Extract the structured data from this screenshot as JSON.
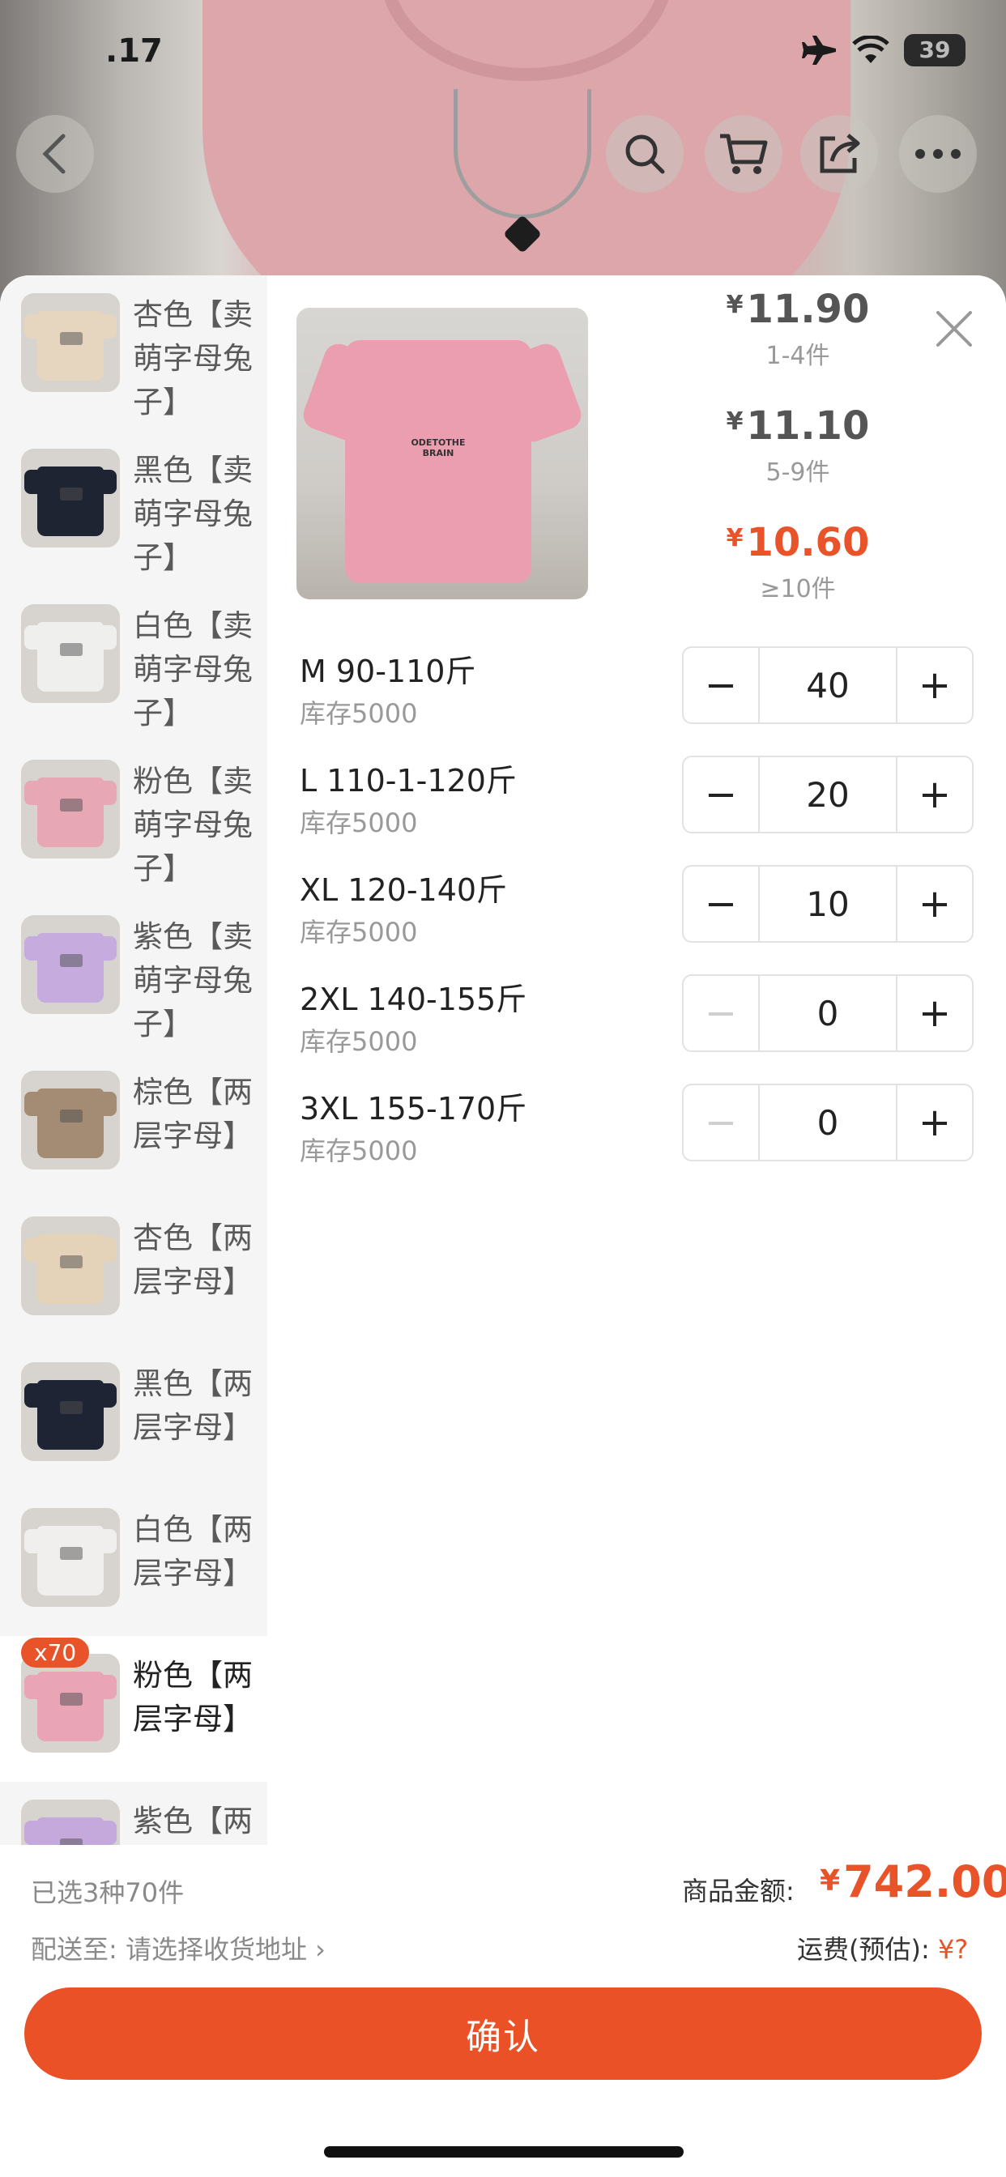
{
  "status": {
    "time": ".17",
    "battery": "39"
  },
  "colors": [
    {
      "name": "杏色【卖萌字母兔子】",
      "swatch": "#e6d5bf",
      "selected": false,
      "badge": ""
    },
    {
      "name": "黑色【卖萌字母兔子】",
      "swatch": "#1f2433",
      "selected": false,
      "badge": ""
    },
    {
      "name": "白色【卖萌字母兔子】",
      "swatch": "#efefee",
      "selected": false,
      "badge": ""
    },
    {
      "name": "粉色【卖萌字母兔子】",
      "swatch": "#e7a7b5",
      "selected": false,
      "badge": ""
    },
    {
      "name": "紫色【卖萌字母兔子】",
      "swatch": "#c5abde",
      "selected": false,
      "badge": ""
    },
    {
      "name": "棕色【两层字母】",
      "swatch": "#a38b74",
      "selected": false,
      "badge": ""
    },
    {
      "name": "杏色【两层字母】",
      "swatch": "#e4d3b8",
      "selected": false,
      "badge": ""
    },
    {
      "name": "黑色【两层字母】",
      "swatch": "#1e2433",
      "selected": false,
      "badge": ""
    },
    {
      "name": "白色【两层字母】",
      "swatch": "#f0efed",
      "selected": false,
      "badge": ""
    },
    {
      "name": "粉色【两层字母】",
      "swatch": "#e9a5b6",
      "selected": true,
      "badge": "x70"
    },
    {
      "name": "紫色【两层字母】",
      "swatch": "#c6a9dc",
      "selected": false,
      "badge": ""
    }
  ],
  "product_image": {
    "print_text": "ODETOTHE BRAIN"
  },
  "price_tiers": [
    {
      "yen": "¥",
      "price": "11.90",
      "range": "1-4件",
      "active": false
    },
    {
      "yen": "¥",
      "price": "11.10",
      "range": "5-9件",
      "active": false
    },
    {
      "yen": "¥",
      "price": "10.60",
      "range": "≥10件",
      "active": true
    }
  ],
  "sizes": [
    {
      "label": "M 90-110斤",
      "stock": "库存5000",
      "qty": "40",
      "minus": "−",
      "plus": "+",
      "minus_disabled": false
    },
    {
      "label": "L 110-1-120斤",
      "stock": "库存5000",
      "qty": "20",
      "minus": "−",
      "plus": "+",
      "minus_disabled": false
    },
    {
      "label": "XL 120-140斤",
      "stock": "库存5000",
      "qty": "10",
      "minus": "−",
      "plus": "+",
      "minus_disabled": false
    },
    {
      "label": "2XL 140-155斤",
      "stock": "库存5000",
      "qty": "0",
      "minus": "−",
      "plus": "+",
      "minus_disabled": true
    },
    {
      "label": "3XL 155-170斤",
      "stock": "库存5000",
      "qty": "0",
      "minus": "−",
      "plus": "+",
      "minus_disabled": true
    }
  ],
  "summary": {
    "selected_text": "已选3种70件",
    "amount_label": "商品金额:",
    "amount_yen": "¥",
    "amount": "742.00",
    "ship_to": "配送至: 请选择收货地址",
    "ship_fee_label": "运费(预估):",
    "ship_fee_value": "¥?",
    "confirm_label": "确认"
  },
  "icons": {
    "back": "chevron-left-icon",
    "search": "search-icon",
    "cart": "cart-icon",
    "share": "share-icon",
    "more": "more-icon",
    "close": "close-icon"
  },
  "colors_theme": {
    "accent": "#e9532a"
  }
}
